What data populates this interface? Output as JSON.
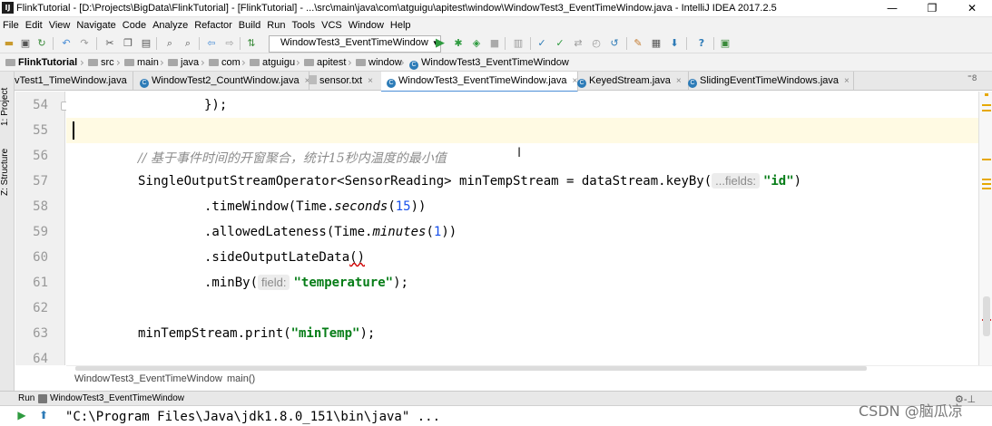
{
  "window": {
    "title": "FlinkTutorial - [D:\\Projects\\BigData\\FlinkTutorial] - [FlinkTutorial] - ...\\src\\main\\java\\com\\atguigu\\apitest\\window\\WindowTest3_EventTimeWindow.java - IntelliJ IDEA 2017.2.5",
    "app_icon": "IJ",
    "minimize": "—",
    "restore": "❐",
    "close": "✕"
  },
  "menu": [
    "File",
    "Edit",
    "View",
    "Navigate",
    "Code",
    "Analyze",
    "Refactor",
    "Build",
    "Run",
    "Tools",
    "VCS",
    "Window",
    "Help"
  ],
  "toolbar": {
    "run_config": "WindowTest3_EventTimeWindow",
    "dropdown_arrow": "▾"
  },
  "breadcrumbs": [
    {
      "label": "FlinkTutorial",
      "icon": "project-folder-icon"
    },
    {
      "label": "src",
      "icon": "folder-icon"
    },
    {
      "label": "main",
      "icon": "folder-icon"
    },
    {
      "label": "java",
      "icon": "folder-icon"
    },
    {
      "label": "com",
      "icon": "package-icon"
    },
    {
      "label": "atguigu",
      "icon": "package-icon"
    },
    {
      "label": "apitest",
      "icon": "package-icon"
    },
    {
      "label": "window",
      "icon": "package-icon"
    },
    {
      "label": "WindowTest3_EventTimeWindow",
      "icon": "class-icon"
    }
  ],
  "tabs": [
    {
      "label": "vTest1_TimeWindow.java",
      "icon": "class-icon",
      "close": "×"
    },
    {
      "label": "WindowTest2_CountWindow.java",
      "icon": "class-icon",
      "close": "×"
    },
    {
      "label": "sensor.txt",
      "icon": "text-file-icon",
      "close": "×"
    },
    {
      "label": "WindowTest3_EventTimeWindow.java",
      "icon": "class-icon",
      "close": "×"
    },
    {
      "label": "KeyedStream.java",
      "icon": "class-icon",
      "close": "×"
    },
    {
      "label": "SlidingEventTimeWindows.java",
      "icon": "class-icon",
      "close": "×"
    }
  ],
  "tab_overflow": "⁼8",
  "tool_windows": {
    "project": "1: Project",
    "structure": "Z: Structure"
  },
  "class_icon_letter": "C",
  "code": {
    "line_numbers": [
      "54",
      "55",
      "56",
      "57",
      "58",
      "59",
      "60",
      "61",
      "62",
      "63",
      "64"
    ],
    "l54": "});",
    "l56_comment": "// 基于事件时间的开窗聚合，统计15秒内温度的最小值",
    "l57_a": "SingleOutputStreamOperator<SensorReading> minTempStream = dataStream.keyBy(",
    "l57_hint": "...fields:",
    "l57_str": "\"id\"",
    "l57_b": ")",
    "l58_a": ".timeWindow(Time.",
    "l58_it": "seconds",
    "l58_b": "(",
    "l58_num": "15",
    "l58_c": "))",
    "l59_a": ".allowedLateness(Time.",
    "l59_it": "minutes",
    "l59_b": "(",
    "l59_num": "1",
    "l59_c": "))",
    "l60_a": ".sideOutputLateData",
    "l60_sq": "()",
    "l61_a": ".minBy(",
    "l61_hint": "field:",
    "l61_str": "\"temperature\"",
    "l61_b": ");",
    "l63_a": "minTempStream.print(",
    "l63_str": "\"minTemp\"",
    "l63_b": ");"
  },
  "editor_breadcrumb": {
    "class": "WindowTest3_EventTimeWindow",
    "sep": "›",
    "method": "main()"
  },
  "run_panel": {
    "label": "Run",
    "config": "WindowTest3_EventTimeWindow",
    "console_line": "\"C:\\Program Files\\Java\\jdk1.8.0_151\\bin\\java\" ...",
    "settings": "⚙-⊥"
  },
  "watermark": "CSDN @脑瓜凉",
  "colors": {
    "accent": "#4a8ed6",
    "string": "#067d17",
    "number": "#1750eb",
    "comment": "#8c8c8c",
    "current_line": "#fffae3",
    "warning_marker": "#e6a800"
  }
}
